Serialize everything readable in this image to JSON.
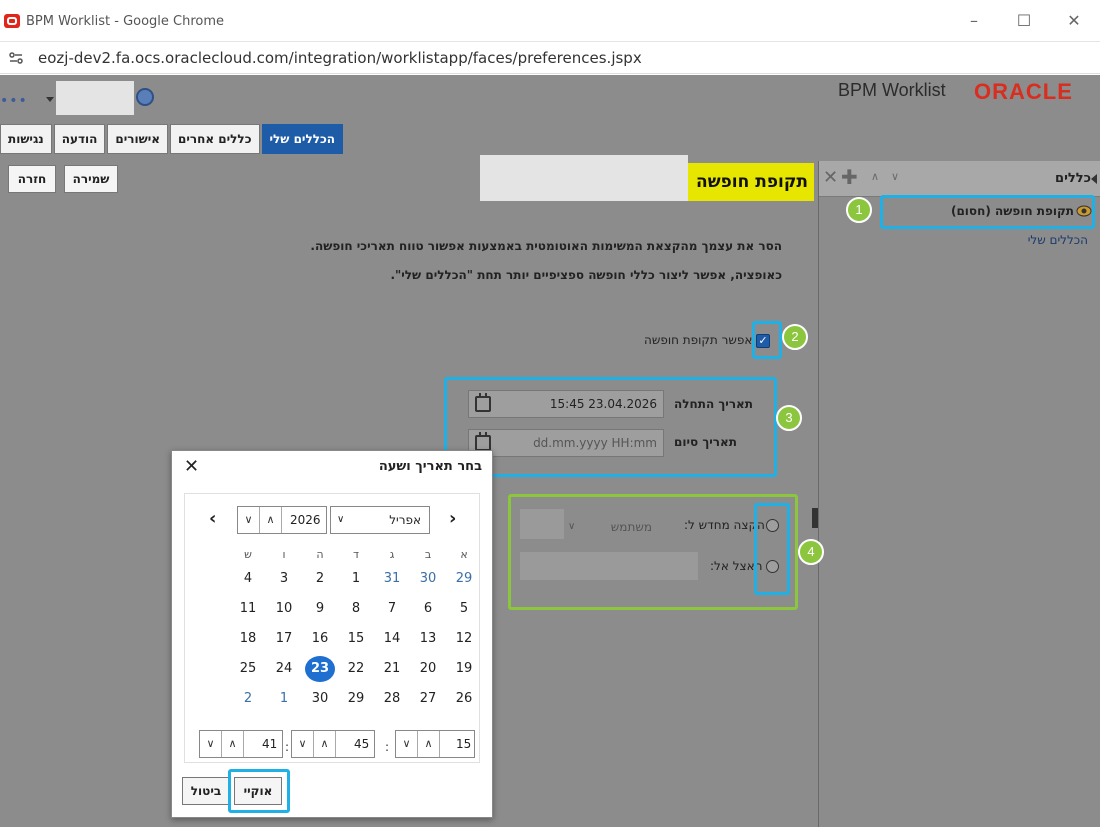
{
  "window": {
    "title": "BPM Worklist - Google Chrome",
    "url": "eozj-dev2.fa.ocs.oraclecloud.com/integration/worklistapp/faces/preferences.jspx",
    "controls": [
      "–",
      "☐",
      "✕"
    ]
  },
  "header": {
    "brand": "BPM Worklist",
    "logo_text": "ORACLE"
  },
  "tabs": [
    "הכללים שלי",
    "כללים אחרים",
    "אישורים",
    "הודעה",
    "נגישות"
  ],
  "actions": {
    "save": "שמירה",
    "back": "חזרה"
  },
  "section_title": "תקופת חופשה",
  "rules_panel": {
    "title": "כללים",
    "selected_rule": "תקופת חופשה (חסום)",
    "my_rules": "הכללים שלי"
  },
  "description": [
    "הסר את עצמך מהקצאת המשימות האוטומטית באמצעות אפשור טווח תאריכי חופשה.",
    "כאופציה, אפשר ליצור כללי חופשה ספציפיים יותר תחת \"הכללים שלי\"."
  ],
  "enable_vacation": {
    "label": "אפשר תקופת חופשה",
    "checked": true
  },
  "start_date": {
    "label": "תאריך התחלה",
    "value": "15:45 23.04.2026"
  },
  "end_date": {
    "label": "תאריך סיום",
    "placeholder": "dd.mm.yyyy HH:mm"
  },
  "reassign": {
    "label": "הקצה מחדש ל:",
    "select_value": "משתמש"
  },
  "delegate": {
    "label": "האצל אל:"
  },
  "callouts": [
    "1",
    "2",
    "3",
    "4"
  ],
  "dialog": {
    "title": "בחר תאריך ושעה",
    "close": "✕",
    "month": "אפריל",
    "year": "2026",
    "weekdays": [
      "א",
      "ב",
      "ג",
      "ד",
      "ה",
      "ו",
      "ש"
    ],
    "weeks": [
      [
        "29",
        "30",
        "31",
        "1",
        "2",
        "3",
        "4"
      ],
      [
        "5",
        "6",
        "7",
        "8",
        "9",
        "10",
        "11"
      ],
      [
        "12",
        "13",
        "14",
        "15",
        "16",
        "17",
        "18"
      ],
      [
        "19",
        "20",
        "21",
        "22",
        "23",
        "24",
        "25"
      ],
      [
        "26",
        "27",
        "28",
        "29",
        "30",
        "1",
        "2"
      ]
    ],
    "selected_day": "23",
    "time": {
      "hours": "15",
      "minutes": "45",
      "seconds": "41"
    },
    "ok": "אוקיי",
    "cancel": "ביטול"
  }
}
